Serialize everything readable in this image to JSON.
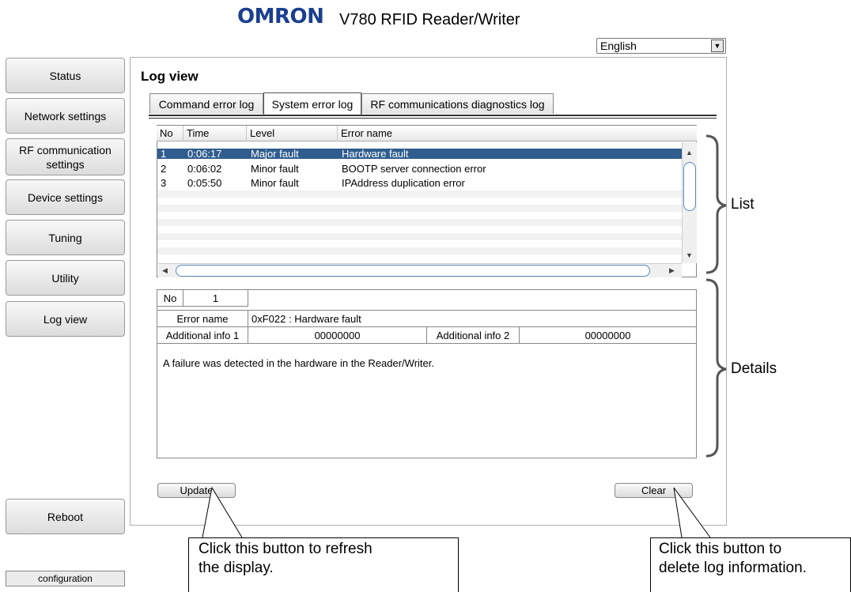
{
  "header": {
    "brand": "OMRON",
    "product": "V780 RFID Reader/Writer",
    "language": "English"
  },
  "sidebar": {
    "items": [
      {
        "label": "Status"
      },
      {
        "label": "Network settings"
      },
      {
        "label": "RF communication settings"
      },
      {
        "label": "Device settings"
      },
      {
        "label": "Tuning"
      },
      {
        "label": "Utility"
      },
      {
        "label": "Log view"
      }
    ],
    "reboot_label": "Reboot",
    "config_label": "configuration"
  },
  "main": {
    "title": "Log view",
    "tabs": [
      {
        "label": "Command error log"
      },
      {
        "label": "System error log",
        "active": true
      },
      {
        "label": "RF communications diagnostics log"
      }
    ],
    "list": {
      "columns": [
        "No",
        "Time",
        "Level",
        "Error name"
      ],
      "rows": [
        {
          "no": "1",
          "time": "0:06:17",
          "level": "Major fault",
          "error": "Hardware fault",
          "selected": true
        },
        {
          "no": "2",
          "time": "0:06:02",
          "level": "Minor fault",
          "error": "BOOTP server connection error"
        },
        {
          "no": "3",
          "time": "0:05:50",
          "level": "Minor fault",
          "error": "IPAddress duplication error"
        }
      ]
    },
    "details": {
      "no_label": "No",
      "no_value": "1",
      "error_name_label": "Error name",
      "error_name_value": "0xF022 : Hardware fault",
      "info1_label": "Additional info 1",
      "info1_value": "00000000",
      "info2_label": "Additional info 2",
      "info2_value": "00000000",
      "description": "A failure was detected in the hardware in the Reader/Writer."
    },
    "update_label": "Update",
    "clear_label": "Clear"
  },
  "annotations": {
    "list_label": "List",
    "details_label": "Details",
    "update_callout_line1": "Click this button to refresh",
    "update_callout_line2": "the display.",
    "clear_callout_line1": "Click this button to",
    "clear_callout_line2": "delete log information."
  },
  "colors": {
    "brand": "#1a3f8f",
    "selected_row": "#2f5d8e",
    "scroll_thumb_border": "#5a87c0"
  }
}
